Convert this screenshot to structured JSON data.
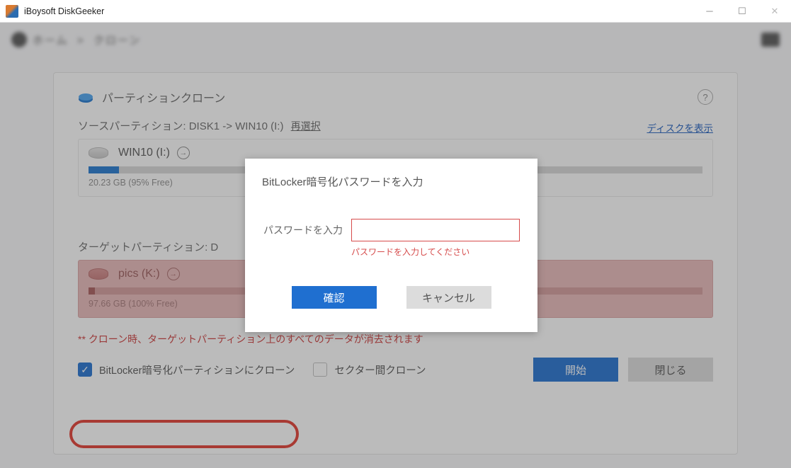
{
  "titlebar": {
    "title": "iBoysoft DiskGeeker"
  },
  "panel": {
    "title": "パーティションクローン",
    "help_tooltip": "?"
  },
  "source": {
    "heading_prefix": "ソースパーティション: ",
    "heading_path": "DISK1 -> WIN10 (I:)",
    "reselect": "再選択",
    "show_disks": "ディスクを表示",
    "name": "WIN10 (I:)",
    "used_percent": 5,
    "caption": "20.23 GB (95% Free)"
  },
  "target": {
    "heading_prefix": "ターゲットパーティション: D",
    "name": "pics (K:)",
    "used_percent": 1,
    "caption": "97.66 GB (100% Free)"
  },
  "warning": "** クローン時、ターゲットパーティション上のすべてのデータが消去されます",
  "options": {
    "bitlocker_clone_label": "BitLocker暗号化パーティションにクローン",
    "bitlocker_clone_checked": true,
    "sector_clone_label": "セクター間クローン",
    "sector_clone_checked": false
  },
  "buttons": {
    "start": "開始",
    "close": "閉じる"
  },
  "modal": {
    "title": "BitLocker暗号化パスワードを入力",
    "label": "パスワードを入力",
    "value": "",
    "error": "パスワードを入力してください",
    "confirm": "確認",
    "cancel": "キャンセル"
  }
}
